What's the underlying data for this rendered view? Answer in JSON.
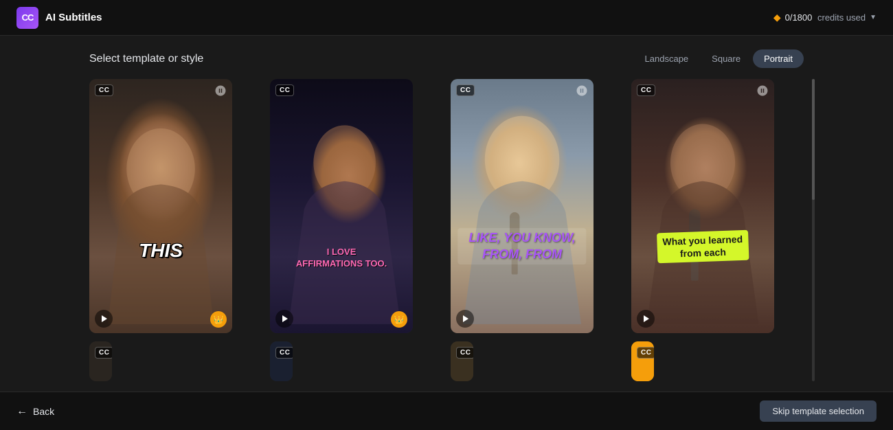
{
  "header": {
    "logo_text": "CC",
    "app_title": "AI Subtitles",
    "credits_label": "0/1800",
    "credits_suffix": "credits used"
  },
  "section": {
    "title": "Select template or style",
    "orientation_tabs": [
      {
        "id": "landscape",
        "label": "Landscape",
        "active": false
      },
      {
        "id": "square",
        "label": "Square",
        "active": false
      },
      {
        "id": "portrait",
        "label": "Portrait",
        "active": true
      }
    ]
  },
  "templates": [
    {
      "id": 1,
      "cc_label": "CC",
      "has_watermark": true,
      "has_premium": true,
      "subtitle_text": "THIS",
      "subtitle_style": "bold-white"
    },
    {
      "id": 2,
      "cc_label": "CC",
      "has_watermark": false,
      "has_premium": true,
      "subtitle_line1": "I LOVE",
      "subtitle_line2": "AFFIRMATIONS TOO.",
      "subtitle_style": "pink-script"
    },
    {
      "id": 3,
      "cc_label": "CC",
      "has_watermark": true,
      "has_premium": false,
      "subtitle_line1": "LIKE, YOU KNOW,",
      "subtitle_line2": "FROM, FROM",
      "subtitle_style": "purple-bold"
    },
    {
      "id": 4,
      "cc_label": "CC",
      "has_watermark": true,
      "has_premium": false,
      "subtitle_line1": "What you learned",
      "subtitle_line2": "from each",
      "subtitle_style": "yellow-sticker"
    }
  ],
  "footer": {
    "back_label": "Back",
    "skip_label": "Skip template selection"
  }
}
